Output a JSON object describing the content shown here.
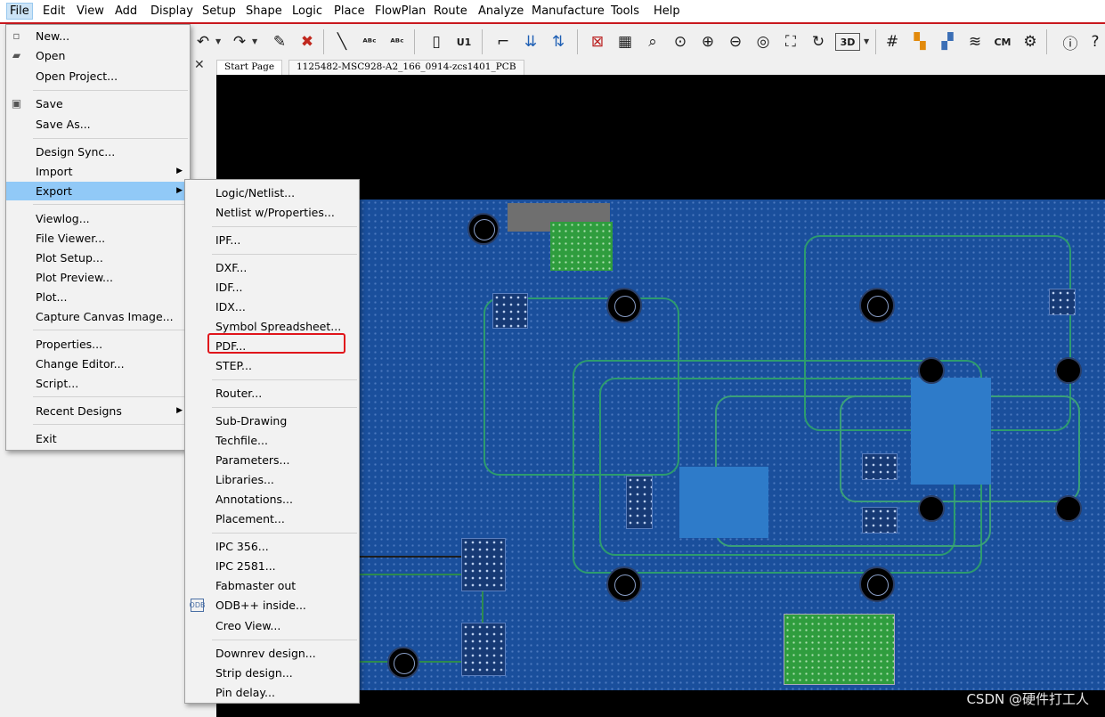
{
  "menubar": {
    "items": [
      "File",
      "Edit",
      "View",
      "Add",
      "Display",
      "Setup",
      "Shape",
      "Logic",
      "Place",
      "FlowPlan",
      "Route",
      "Analyze",
      "Manufacture",
      "Tools",
      "Help"
    ]
  },
  "tabs": {
    "start": "Start Page",
    "design": "1125482-MSC928-A2_166_0914-zcs1401_PCB"
  },
  "file_menu": {
    "items": [
      {
        "label": "New...",
        "icon": "new-file-icon"
      },
      {
        "label": "Open",
        "icon": "folder-open-icon"
      },
      {
        "label": "Open Project..."
      },
      {
        "label": "Save",
        "icon": "floppy-disk-icon"
      },
      {
        "label": "Save As..."
      },
      {
        "label": "Design Sync..."
      },
      {
        "label": "Import",
        "submenu": true
      },
      {
        "label": "Export",
        "submenu": true,
        "highlighted": true
      },
      {
        "label": "Viewlog..."
      },
      {
        "label": "File Viewer..."
      },
      {
        "label": "Plot Setup..."
      },
      {
        "label": "Plot Preview..."
      },
      {
        "label": "Plot..."
      },
      {
        "label": "Capture Canvas Image..."
      },
      {
        "label": "Properties..."
      },
      {
        "label": "Change Editor..."
      },
      {
        "label": "Script..."
      },
      {
        "label": "Recent Designs",
        "submenu": true
      },
      {
        "label": "Exit"
      }
    ]
  },
  "export_menu": {
    "items": [
      {
        "label": "Logic/Netlist..."
      },
      {
        "label": "Netlist w/Properties..."
      },
      {
        "label": "IPF..."
      },
      {
        "label": "DXF..."
      },
      {
        "label": "IDF..."
      },
      {
        "label": "IDX..."
      },
      {
        "label": "Symbol Spreadsheet..."
      },
      {
        "label": "PDF...",
        "boxed": true
      },
      {
        "label": "STEP..."
      },
      {
        "label": "Router..."
      },
      {
        "label": "Sub-Drawing"
      },
      {
        "label": "Techfile..."
      },
      {
        "label": "Parameters..."
      },
      {
        "label": "Libraries..."
      },
      {
        "label": "Annotations..."
      },
      {
        "label": "Placement..."
      },
      {
        "label": "IPC 356..."
      },
      {
        "label": "IPC 2581..."
      },
      {
        "label": "Fabmaster out"
      },
      {
        "label": "ODB++ inside...",
        "icon": "odb-icon"
      },
      {
        "label": "Creo View..."
      },
      {
        "label": "Downrev design..."
      },
      {
        "label": "Strip design..."
      },
      {
        "label": "Pin delay..."
      }
    ]
  },
  "toolbar": {
    "icons": [
      "undo-icon",
      "redo-icon",
      "pin-icon",
      "unpin-icon",
      "add-line-icon",
      "add-text-icon",
      "edit-text-icon",
      "place-component-icon",
      "component-refdes-icon",
      "route-connect-icon",
      "slide-icon",
      "delay-tune-icon",
      "ratsnest-icon",
      "unrats-icon",
      "zoom-window-icon",
      "zoom-fit-icon",
      "zoom-in-icon",
      "zoom-out-icon",
      "zoom-world-icon",
      "zoom-selection-icon",
      "redraw-icon",
      "3d-view-icon",
      "grid-toggle-icon",
      "color-icon",
      "shadow-icon",
      "layers-icon",
      "cm-icon",
      "settings-grid-icon",
      "info-icon"
    ],
    "view_3d_label": "3D"
  },
  "watermark": "CSDN @硬件打工人",
  "colors": {
    "board": "#1a4f9c",
    "trace": "#2d9c6e",
    "highlight": "#91c9f7",
    "red_box": "#e0151b"
  }
}
